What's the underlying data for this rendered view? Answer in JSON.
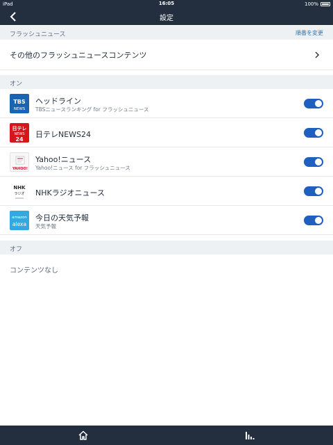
{
  "status_bar": {
    "device": "iPad",
    "time": "16:05",
    "battery": "100%"
  },
  "nav": {
    "title": "設定",
    "back_icon": "chevron-left-icon"
  },
  "flash_section": {
    "label": "フラッシュニュース",
    "action": "順番を変更"
  },
  "other_content_row": {
    "label": "その他のフラッシュニュースコンテンツ"
  },
  "on_section": {
    "label": "オン"
  },
  "items": [
    {
      "name": "ヘッドライン",
      "sub": "TBSニュースランキング for フラッシュニュース",
      "logo_text": "TBS NEWS",
      "enabled": true
    },
    {
      "name": "日テレNEWS24",
      "sub": "",
      "logo_text": "日テレ NEWS 24",
      "enabled": true
    },
    {
      "name": "Yahoo!ニュース",
      "sub": "Yahoo!ニュース for フラッシュニュース",
      "logo_text": "YAHOO!",
      "enabled": true
    },
    {
      "name": "NHKラジオニュース",
      "sub": "",
      "logo_text": "NHK ラジオニュース",
      "enabled": true
    },
    {
      "name": "今日の天気予報",
      "sub": "天気予報",
      "logo_text": "amazon alexa",
      "enabled": true
    }
  ],
  "off_section": {
    "label": "オフ"
  },
  "off_empty": "コンテンツなし",
  "tab_bar": {
    "items": [
      "home-icon",
      "equalizer-icon"
    ]
  },
  "colors": {
    "nav_bg": "#232f3e",
    "accent": "#2e75b6",
    "toggle_on": "#1f5fbf",
    "section_bg": "#eef1f4"
  }
}
